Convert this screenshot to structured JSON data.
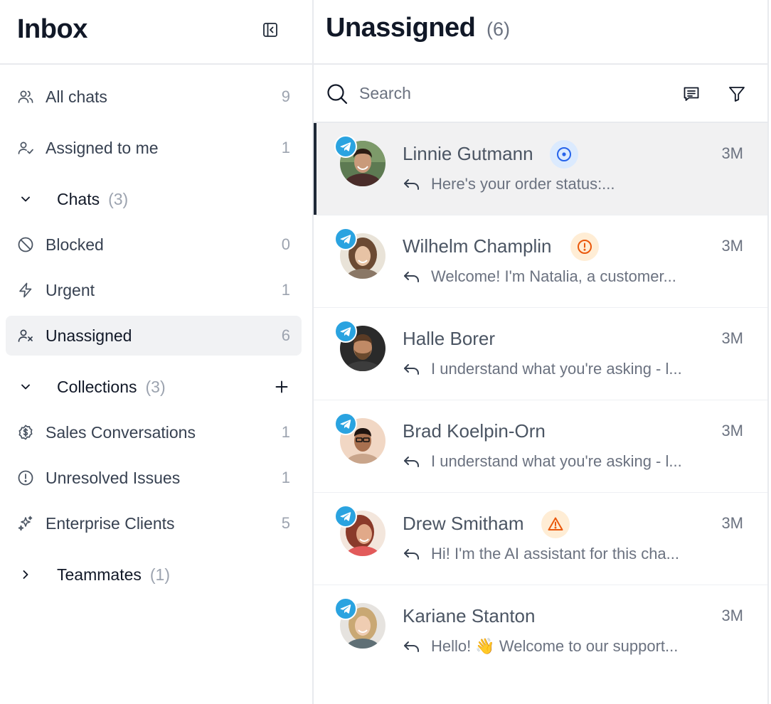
{
  "sidebar": {
    "title": "Inbox",
    "items": [
      {
        "label": "All chats",
        "count": "9",
        "icon": "users-icon"
      },
      {
        "label": "Assigned to me",
        "count": "1",
        "icon": "user-check-icon"
      },
      {
        "label": "Blocked",
        "count": "0",
        "icon": "blocked-icon"
      },
      {
        "label": "Urgent",
        "count": "1",
        "icon": "lightning-icon"
      },
      {
        "label": "Unassigned",
        "count": "6",
        "icon": "user-x-icon"
      }
    ],
    "sections": {
      "chats": {
        "label": "Chats",
        "count": "(3)"
      },
      "collections": {
        "label": "Collections",
        "count": "(3)"
      },
      "teammates": {
        "label": "Teammates",
        "count": "(1)"
      }
    },
    "collections": [
      {
        "label": "Sales Conversations",
        "count": "1",
        "icon": "dollar-circle-icon"
      },
      {
        "label": "Unresolved Issues",
        "count": "1",
        "icon": "alert-circle-icon"
      },
      {
        "label": "Enterprise Clients",
        "count": "5",
        "icon": "sparkles-icon"
      }
    ]
  },
  "main": {
    "title": "Unassigned",
    "count": "(6)",
    "search": {
      "placeholder": "Search"
    },
    "conversations": [
      {
        "name": "Linnie Gutmann",
        "time": "3M",
        "preview": "Here's your order status:...",
        "status": "active",
        "channel": "telegram"
      },
      {
        "name": "Wilhelm Champlin",
        "time": "3M",
        "preview": "Welcome! I'm Natalia, a customer...",
        "status": "urgent",
        "channel": "telegram"
      },
      {
        "name": "Halle Borer",
        "time": "3M",
        "preview": "I understand what you're asking - l...",
        "status": "",
        "channel": "telegram"
      },
      {
        "name": "Brad Koelpin-Orn",
        "time": "3M",
        "preview": "I understand what you're asking - l...",
        "status": "",
        "channel": "telegram"
      },
      {
        "name": "Drew Smitham",
        "time": "3M",
        "preview": "Hi! I'm the AI assistant for this cha...",
        "status": "warning",
        "channel": "telegram"
      },
      {
        "name": "Kariane Stanton",
        "time": "3M",
        "preview": "Hello! 👋 Welcome to our support...",
        "status": "",
        "channel": "telegram"
      }
    ]
  },
  "colors": {
    "telegram": "#2aa3e0",
    "active_status": "#2563eb",
    "urgent_status": "#ea580c",
    "warning_status": "#ea580c"
  }
}
